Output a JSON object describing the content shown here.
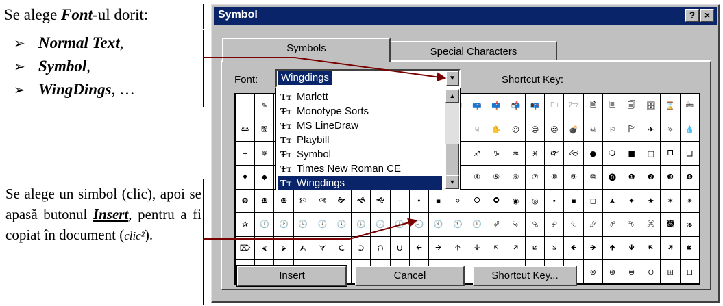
{
  "annotation": {
    "title_prefix": "Se alege ",
    "title_bold": "Font",
    "title_suffix": "-ul dorit:",
    "list": [
      {
        "bold": "Normal Text",
        "tail": ","
      },
      {
        "bold": "Symbol",
        "tail": ","
      },
      {
        "bold": "WingDings",
        "tail": ", …"
      }
    ],
    "para_1": "Se alege un simbol (clic), apoi se apasă butonul ",
    "para_insert": "Insert",
    "para_2": ", pentru a fi copiat în document (",
    "para_clic": "clic²",
    "para_3": ")."
  },
  "dialog": {
    "title": "Symbol",
    "help_label": "?",
    "close_label": "×",
    "tabs": [
      {
        "label": "Symbols",
        "active": true
      },
      {
        "label": "Special Characters",
        "active": false
      }
    ],
    "font_label": "Font:",
    "font_value": "Wingdings",
    "shortcut_key_label": "Shortcut Key:",
    "font_options": [
      {
        "label": "Marlett",
        "selected": false
      },
      {
        "label": "Monotype Sorts",
        "selected": false
      },
      {
        "label": "MS LineDraw",
        "selected": false
      },
      {
        "label": "Playbill",
        "selected": false
      },
      {
        "label": "Symbol",
        "selected": false
      },
      {
        "label": "Times New Roman CE",
        "selected": false
      },
      {
        "label": "Wingdings",
        "selected": true
      }
    ],
    "font_type_icon": "truetype-icon",
    "buttons": {
      "insert": "Insert",
      "cancel": "Cancel",
      "shortcut": "Shortcut Key..."
    },
    "symbol_rows": [
      [
        " ",
        "✎",
        "✂",
        "✁",
        "👓",
        "🕭",
        "🕮",
        "🕯",
        "🕿",
        "✆",
        "🖂",
        "🖃",
        "📪",
        "📫",
        "📬",
        "📭",
        "🗀",
        "🗁",
        "🗎",
        "🗏",
        "🗐",
        "🗄",
        "⌛",
        "🖮",
        "🖰",
        "🖲",
        "🖳",
        "▬",
        "▬",
        "▬",
        "▬",
        "▬"
      ],
      [
        "🖴",
        "🖫",
        "🖬",
        "✇",
        "✍",
        "✌",
        "👌",
        "👍",
        "👎",
        "☜",
        "☞",
        "☝",
        "☟",
        "✋",
        "☺",
        "😐",
        "☹",
        "💣",
        "☠",
        "⚐",
        "🏱",
        "✈",
        "☼",
        "💧",
        "❄",
        "🕆",
        "✞",
        "🕈",
        "✠",
        "✡",
        "☪",
        "☯"
      ],
      [
        "+",
        "✵",
        "☪",
        "☸",
        "♈",
        "♉",
        "♊",
        "♋",
        "♌",
        "♍",
        "♎",
        "♏",
        "♐",
        "♑",
        "♒",
        "♓",
        "🙰",
        "🙵",
        "●",
        "🔾",
        "■",
        "□",
        "🞐",
        "❑",
        "❒",
        "⬧",
        "⧫",
        "◆",
        "❖",
        "⬥",
        "⌧",
        "⍓"
      ],
      [
        "♦",
        "◆",
        "❖",
        "⌘",
        "🏵",
        "🏶",
        "🙖",
        "🙗",
        "⓪",
        "①",
        "②",
        "③",
        "④",
        "⑤",
        "⑥",
        "⑦",
        "⑧",
        "⑨",
        "⑩",
        "⓿",
        "❶",
        "❷",
        "❸",
        "❹",
        "❺",
        "❻",
        "❼",
        "❽",
        "❾",
        "❿",
        "🙢",
        "🙠"
      ],
      [
        "❾",
        "❿",
        "❿",
        "🙡",
        "🙣",
        "🙞",
        "🙜",
        "🙝",
        "·",
        "•",
        "▪",
        "⚪",
        "🞆",
        "🞈",
        "◉",
        "◎",
        "🞍",
        "▪",
        "◻",
        "🟂",
        "✦",
        "★",
        "✶",
        "✴",
        "✹",
        "✵",
        "⯐",
        "⌖",
        "⟡",
        "⌑",
        "⯑",
        "✪"
      ],
      [
        "✰",
        "🕐",
        "🕑",
        "🕒",
        "🕓",
        "🕔",
        "🕕",
        "🕖",
        "🕗",
        "🕘",
        "🕙",
        "🕚",
        "🕛",
        "⮰",
        "⮱",
        "⮲",
        "⮳",
        "⮴",
        "⮵",
        "⮶",
        "⮷",
        "🙪",
        "🙫",
        "🙕",
        "🙔",
        "🙗",
        "🙖",
        "🙐",
        "🙑",
        "🙒",
        "🙓",
        "⌫"
      ],
      [
        "⌦",
        "⮘",
        "⮚",
        "⮙",
        "⮛",
        "⮈",
        "⮊",
        "⮉",
        "⮋",
        "🡨",
        "🡪",
        "🡩",
        "🡫",
        "🡬",
        "🡭",
        "🡯",
        "🡮",
        "🡸",
        "🡺",
        "🡹",
        "🡻",
        "🡼",
        "🡽",
        "🡿",
        "🡾",
        "⇦",
        "⇨",
        "⇧",
        "⇩",
        "⬄",
        "⇳",
        "⬀"
      ],
      [
        "⬁",
        "⬃",
        "⬂",
        "🢬",
        "🢭",
        "🗶",
        "✔",
        "🗷",
        "🗹",
        "⊞",
        "⊟",
        "⊠",
        "⊡",
        "⊕",
        "⊖",
        "⊗",
        "⊘",
        "⊙",
        "⊚",
        "⊛",
        "⊜",
        "⊝",
        "⊞",
        "⊟",
        "⊠",
        "⊡",
        "⊢",
        "⊣",
        "⊤",
        "⊥",
        "⊦",
        "⊧"
      ]
    ]
  }
}
